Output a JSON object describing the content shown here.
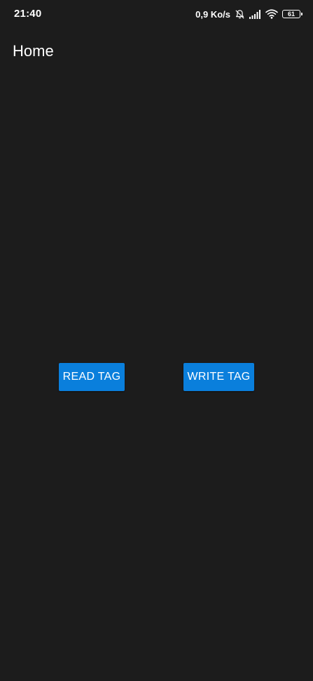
{
  "status_bar": {
    "time": "21:40",
    "network_speed": "0,9 Ko/s",
    "battery_level": "61",
    "icons": [
      "bell-off-icon",
      "signal-icon",
      "wifi-icon",
      "battery-icon"
    ]
  },
  "app_bar": {
    "title": "Home"
  },
  "actions": {
    "read_label": "READ TAG",
    "write_label": "WRITE TAG"
  },
  "colors": {
    "background": "#1c1c1c",
    "button": "#0a7fdc",
    "text": "#ffffff"
  }
}
